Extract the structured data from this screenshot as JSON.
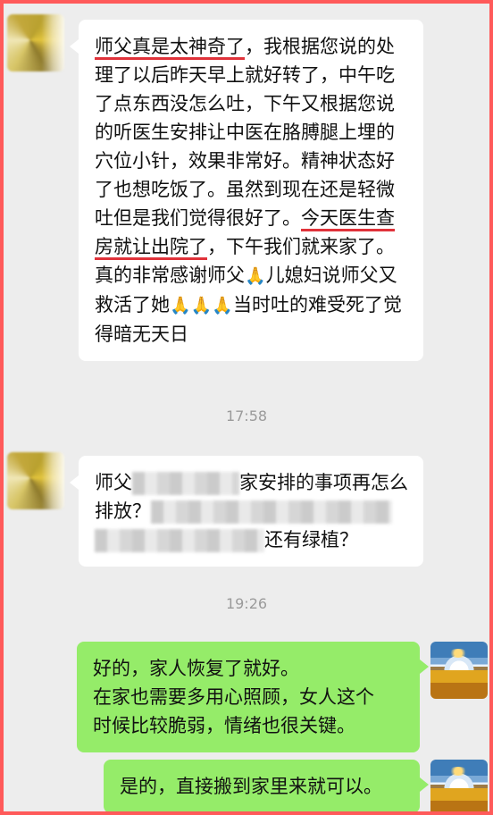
{
  "messages": [
    {
      "direction": "incoming",
      "parts": {
        "hl1": "师父真是太神奇了",
        "p1": "，我根据您说的处理了以后昨天早上就好转了，中午吃了点东西没怎么吐，下午又根据您说的听医生安排让中医在胳膊腿上埋的穴位小针，效果非常好。精神状态好了也想吃饭了。虽然到现在还是轻微吐但是我们觉得很好了。",
        "hl2": "今天医生查房就让出院了",
        "p2": "，下午我们就来家了。真的非常感谢师父",
        "p3": "儿媳妇说师父又救活了她",
        "p4": "当时吐的难受死了觉得暗无天日"
      },
      "emoji_icon": "folded-hands"
    },
    {
      "type": "timestamp",
      "text": "17:58"
    },
    {
      "direction": "incoming",
      "parts": {
        "p1": "师父",
        "p2": "家安排的事项再怎么",
        "p3": "排放？",
        "p4": "还有绿植？"
      },
      "redacted": true
    },
    {
      "type": "timestamp",
      "text": "19:26"
    },
    {
      "direction": "outgoing",
      "lines": [
        "好的，家人恢复了就好。",
        "在家也需要多用心照顾，女人这个",
        "时候比较脆弱，情绪也很关键。"
      ]
    },
    {
      "direction": "outgoing",
      "lines": [
        "是的，直接搬到家里来就可以。"
      ]
    }
  ],
  "colors": {
    "frame_border": "#ff5a5a",
    "chat_bg": "#ededed",
    "incoming_bubble": "#ffffff",
    "outgoing_bubble": "#95ec69",
    "highlight_underline": "#e0323a",
    "timestamp_text": "#9a9a9a"
  }
}
